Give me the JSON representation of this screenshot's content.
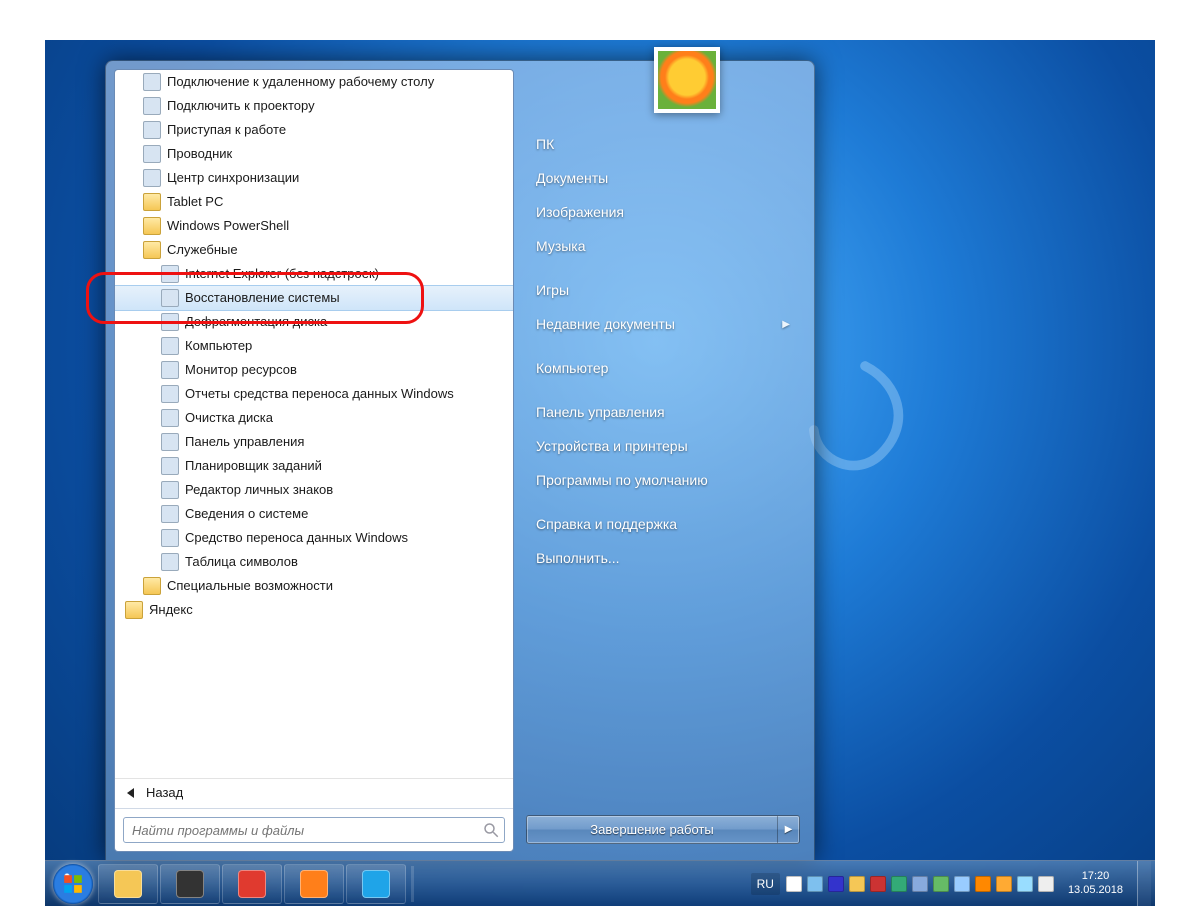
{
  "start_menu": {
    "programs": {
      "items": [
        {
          "label": "Подключение к удаленному рабочему столу",
          "icon": "rdp-icon",
          "indent": 1
        },
        {
          "label": "Подключить к проектору",
          "icon": "projector-icon",
          "indent": 1
        },
        {
          "label": "Приступая к работе",
          "icon": "getting-started-icon",
          "indent": 1
        },
        {
          "label": "Проводник",
          "icon": "explorer-icon",
          "indent": 1
        },
        {
          "label": "Центр синхронизации",
          "icon": "sync-center-icon",
          "indent": 1
        },
        {
          "label": "Tablet PC",
          "icon": "folder-icon",
          "indent": 1
        },
        {
          "label": "Windows PowerShell",
          "icon": "folder-icon",
          "indent": 1
        },
        {
          "label": "Служебные",
          "icon": "folder-icon",
          "indent": 1
        },
        {
          "label": "Internet Explorer (без надстроек)",
          "icon": "ie-icon",
          "indent": 2
        },
        {
          "label": "Восстановление системы",
          "icon": "system-restore-icon",
          "indent": 2,
          "hovered": true,
          "highlighted": true
        },
        {
          "label": "Дефрагментация диска",
          "icon": "defrag-icon",
          "indent": 2
        },
        {
          "label": "Компьютер",
          "icon": "computer-icon",
          "indent": 2
        },
        {
          "label": "Монитор ресурсов",
          "icon": "resource-monitor-icon",
          "indent": 2
        },
        {
          "label": "Отчеты средства переноса данных Windows",
          "icon": "easy-transfer-reports-icon",
          "indent": 2
        },
        {
          "label": "Очистка диска",
          "icon": "disk-cleanup-icon",
          "indent": 2
        },
        {
          "label": "Панель управления",
          "icon": "control-panel-icon",
          "indent": 2
        },
        {
          "label": "Планировщик заданий",
          "icon": "task-scheduler-icon",
          "indent": 2
        },
        {
          "label": "Редактор личных знаков",
          "icon": "private-char-editor-icon",
          "indent": 2
        },
        {
          "label": "Сведения о системе",
          "icon": "system-info-icon",
          "indent": 2
        },
        {
          "label": "Средство переноса данных Windows",
          "icon": "easy-transfer-icon",
          "indent": 2
        },
        {
          "label": "Таблица символов",
          "icon": "charmap-icon",
          "indent": 2
        },
        {
          "label": "Специальные возможности",
          "icon": "folder-icon",
          "indent": 1
        },
        {
          "label": "Яндекс",
          "icon": "folder-icon",
          "indent": 0
        }
      ],
      "back_label": "Назад"
    },
    "search_placeholder": "Найти программы и файлы",
    "right": {
      "items": [
        {
          "label": "ПК",
          "name": "user-folder"
        },
        {
          "label": "Документы",
          "name": "documents"
        },
        {
          "label": "Изображения",
          "name": "pictures"
        },
        {
          "label": "Музыка",
          "name": "music"
        },
        {
          "label": "Игры",
          "name": "games"
        },
        {
          "label": "Недавние документы",
          "name": "recent-documents",
          "submenu": true
        },
        {
          "label": "Компьютер",
          "name": "computer"
        },
        {
          "label": "Панель управления",
          "name": "control-panel"
        },
        {
          "label": "Устройства и принтеры",
          "name": "devices-printers"
        },
        {
          "label": "Программы по умолчанию",
          "name": "default-programs"
        },
        {
          "label": "Справка и поддержка",
          "name": "help-support"
        },
        {
          "label": "Выполнить...",
          "name": "run"
        }
      ],
      "group_breaks_after": [
        "music",
        "recent-documents",
        "computer",
        "default-programs"
      ]
    },
    "shutdown_label": "Завершение работы"
  },
  "taskbar": {
    "pinned": [
      {
        "name": "explorer",
        "color": "#f5c756"
      },
      {
        "name": "panda-app",
        "color": "#333"
      },
      {
        "name": "opera",
        "color": "#e03a2f"
      },
      {
        "name": "firefox",
        "color": "#ff7f1a"
      },
      {
        "name": "skype",
        "color": "#1fa4e8"
      }
    ],
    "lang": "RU",
    "tray_icons": [
      "show-hidden-icon",
      "headset-icon",
      "skype-tray-icon",
      "flag-icon",
      "java-icon",
      "floppy-icon",
      "chart-icon",
      "signal-icon",
      "monitor-icon",
      "shield-icon",
      "av-icon",
      "network-wifi-icon",
      "volume-icon"
    ],
    "clock": {
      "time": "17:20",
      "date": "13.05.2018"
    }
  },
  "colors": {
    "highlight_border": "#e11",
    "hover_bg_top": "#e6f1fb",
    "hover_bg_bottom": "#cfe5f9"
  }
}
